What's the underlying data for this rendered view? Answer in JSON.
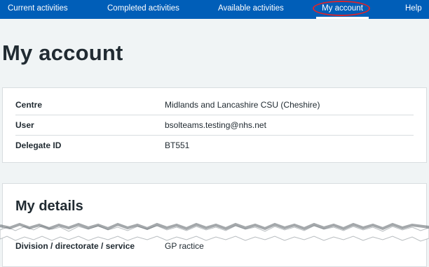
{
  "nav": {
    "items": [
      {
        "label": "Current activities"
      },
      {
        "label": "Completed activities"
      },
      {
        "label": "Available activities"
      },
      {
        "label": "My account"
      },
      {
        "label": "Help"
      }
    ]
  },
  "page_title": "My account",
  "account": {
    "rows": [
      {
        "label": "Centre",
        "value": "Midlands and Lancashire CSU (Cheshire)"
      },
      {
        "label": "User",
        "value": "bsolteams.testing@nhs.net"
      },
      {
        "label": "Delegate ID",
        "value": "BT551"
      }
    ]
  },
  "details": {
    "heading": "My details",
    "partial_row": {
      "label": "Division / directorate / service",
      "value": "GP ractice"
    }
  },
  "colors": {
    "nav_bg": "#005eb8",
    "highlight_circle": "#d9262e",
    "page_bg": "#f0f4f5"
  }
}
